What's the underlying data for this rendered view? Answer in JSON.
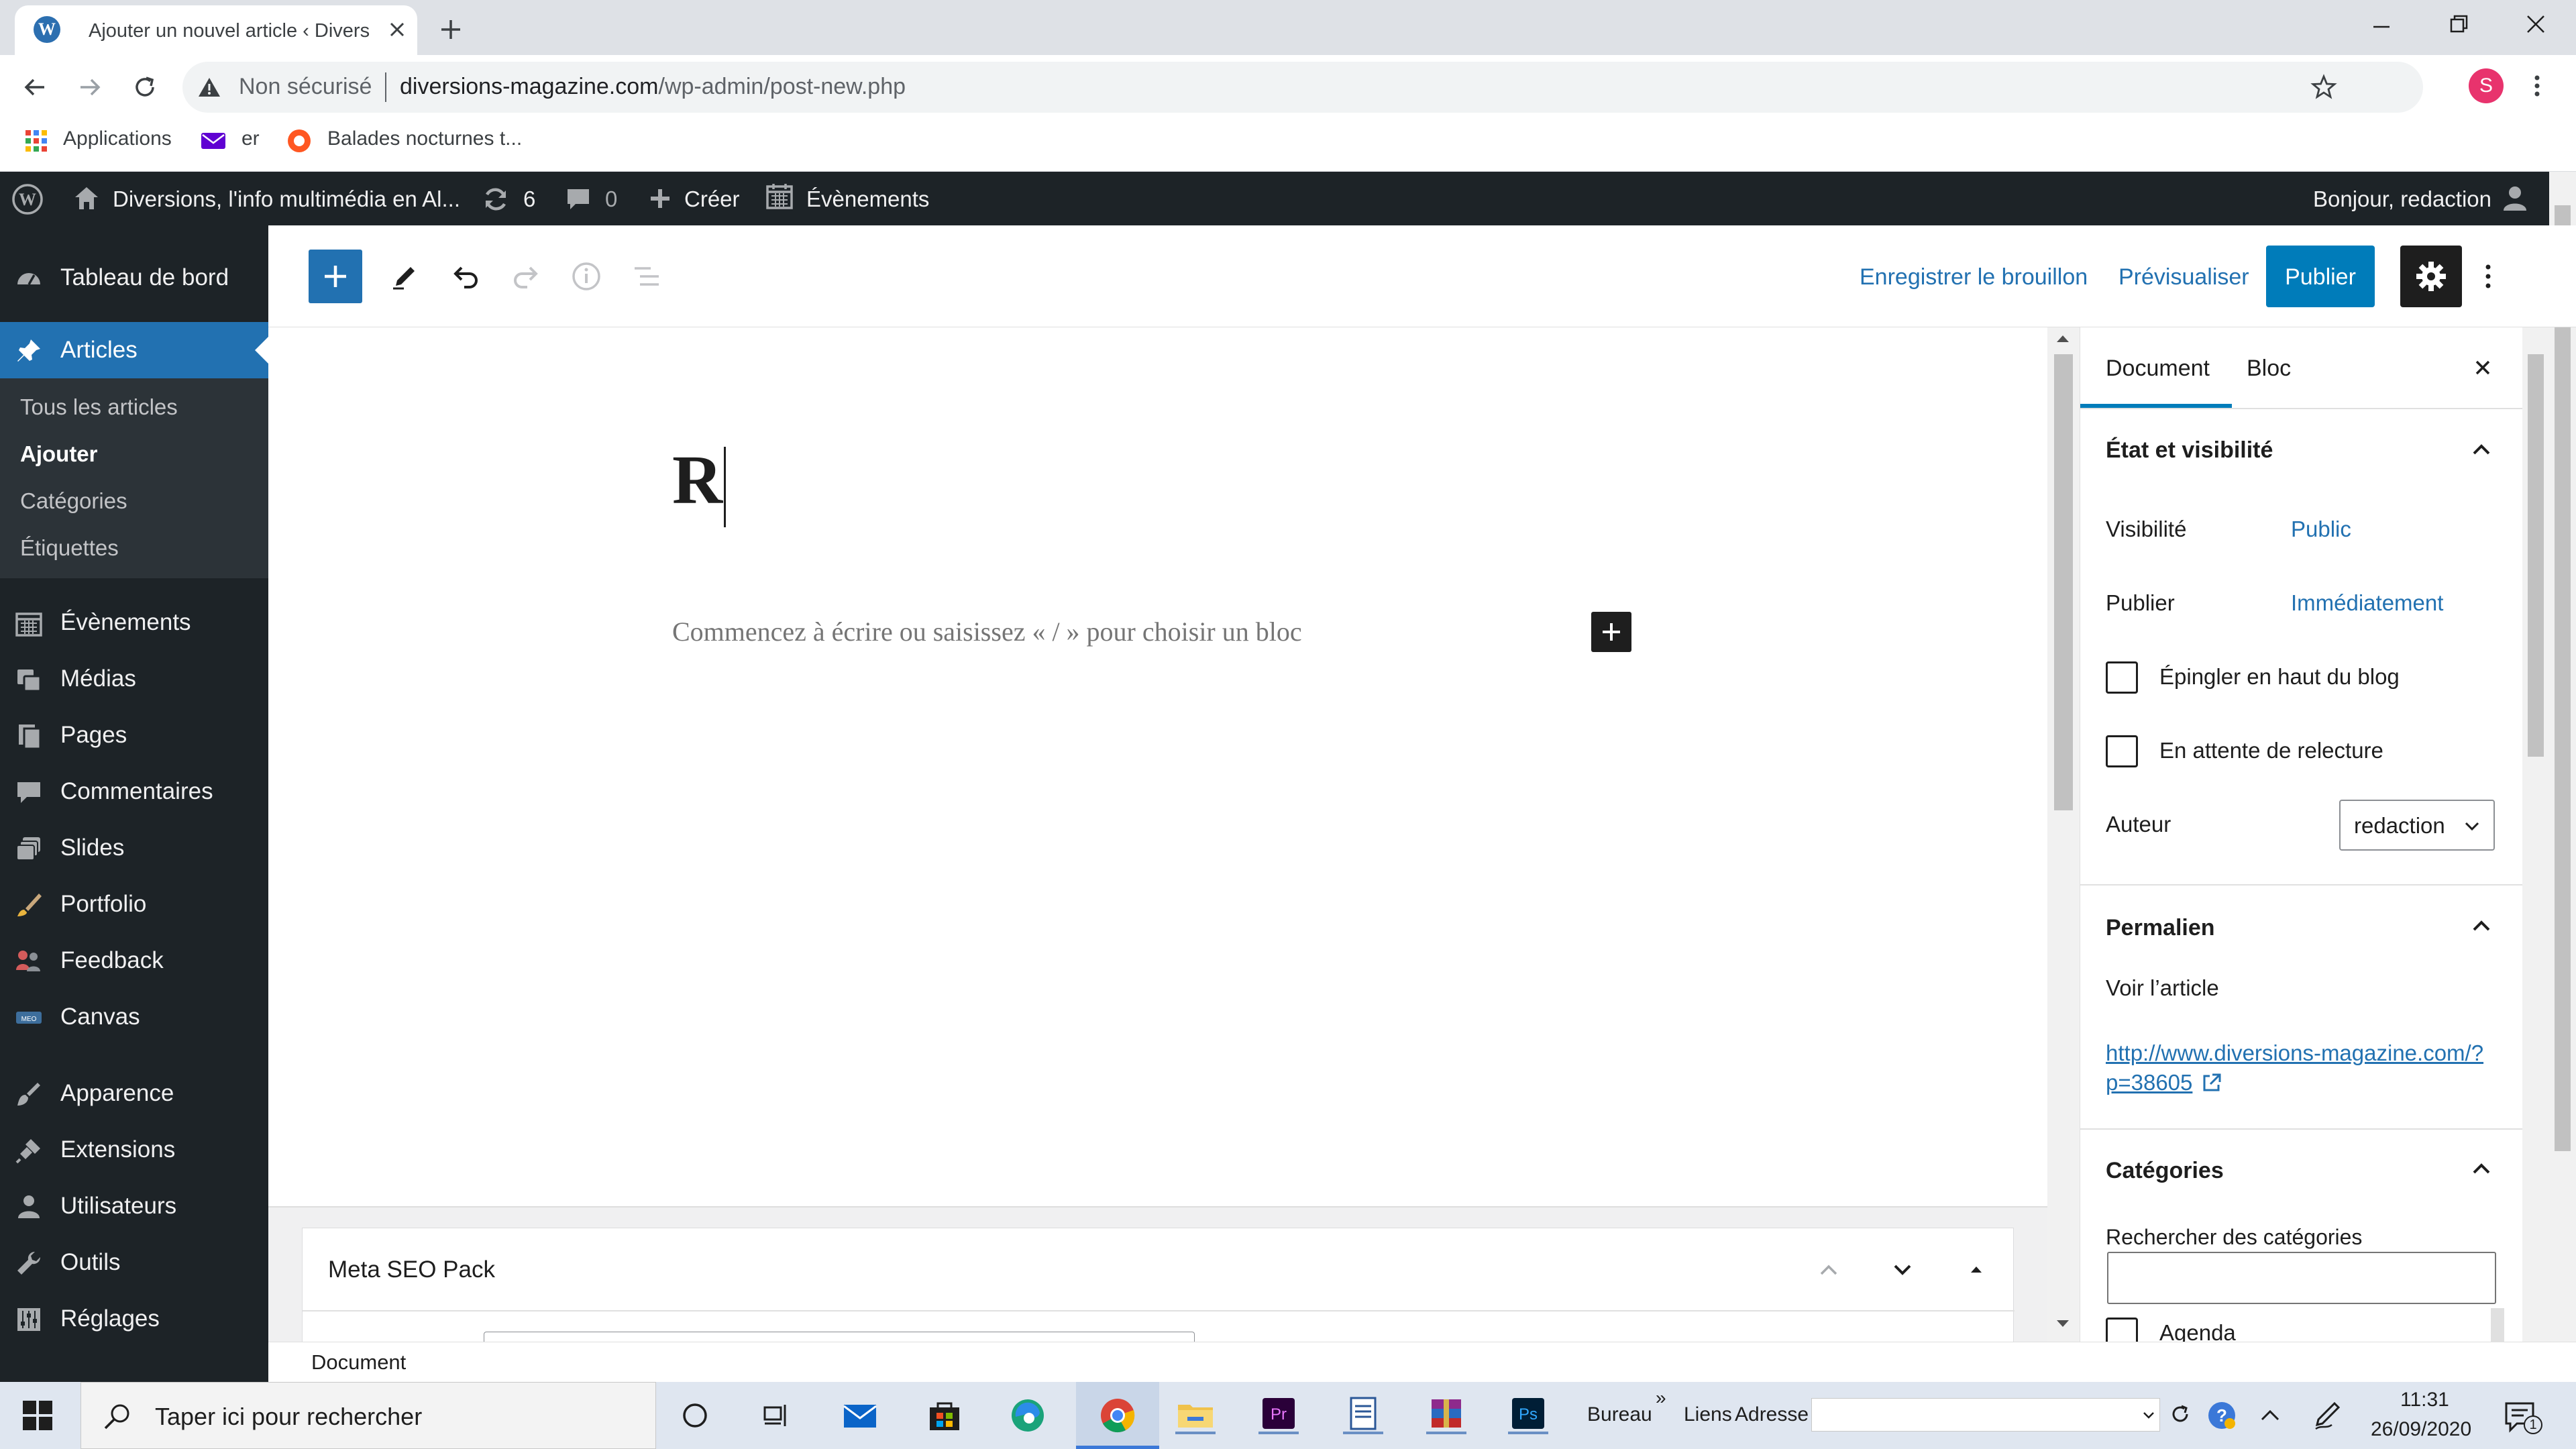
{
  "browser": {
    "tab_title": "Ajouter un nouvel article ‹ Diversions",
    "security_label": "Non sécurisé",
    "url_host": "diversions-magazine.com",
    "url_path": "/wp-admin/post-new.php",
    "profile_initial": "S",
    "bookmarks": [
      {
        "label": "Applications",
        "icon": "apps-grid-icon"
      },
      {
        "label": "er",
        "icon": "mail-icon"
      },
      {
        "label": "Balades nocturnes t...",
        "icon": "bookmark-site-icon"
      }
    ]
  },
  "admin_bar": {
    "site_name": "Diversions, l'info multimédia en Al...",
    "updates_count": "6",
    "comments_count": "0",
    "create_label": "Créer",
    "events_label": "Évènements",
    "greeting": "Bonjour, redaction"
  },
  "admin_menu": {
    "dashboard": "Tableau de bord",
    "articles": "Articles",
    "submenu": [
      "Tous les articles",
      "Ajouter",
      "Catégories",
      "Étiquettes"
    ],
    "items": [
      "Évènements",
      "Médias",
      "Pages",
      "Commentaires",
      "Slides",
      "Portfolio",
      "Feedback",
      "Canvas"
    ],
    "items2": [
      "Apparence",
      "Extensions",
      "Utilisateurs",
      "Outils",
      "Réglages"
    ]
  },
  "editor": {
    "save_draft": "Enregistrer le brouillon",
    "preview": "Prévisualiser",
    "publish": "Publier",
    "title_value": "R",
    "block_placeholder": "Commencez à écrire ou saisissez « / » pour choisir un bloc",
    "metabox_title": "Meta SEO Pack",
    "footer_breadcrumb": "Document"
  },
  "sidebar": {
    "tab_document": "Document",
    "tab_block": "Bloc",
    "status_section": "État et visibilité",
    "visibility_label": "Visibilité",
    "visibility_value": "Public",
    "publish_label": "Publier",
    "publish_value": "Immédiatement",
    "sticky_label": "Épingler en haut du blog",
    "pending_label": "En attente de relecture",
    "author_label": "Auteur",
    "author_value": "redaction",
    "permalink_section": "Permalien",
    "view_article": "Voir l’article",
    "permalink_line1": "http://www.diversions-magazine.com/?",
    "permalink_line2": "p=38605",
    "categories_section": "Catégories",
    "search_categories": "Rechercher des catégories",
    "first_category": "Agenda"
  },
  "taskbar": {
    "search_placeholder": "Taper ici pour rechercher",
    "desktop_label": "Bureau",
    "links_label": "Liens",
    "address_label": "Adresse",
    "time": "11:31",
    "date": "26/09/2020",
    "notification_count": "1"
  },
  "colors": {
    "wp_blue": "#007cba",
    "admin_dark": "#1d2327",
    "active_menu": "#2271b1"
  }
}
